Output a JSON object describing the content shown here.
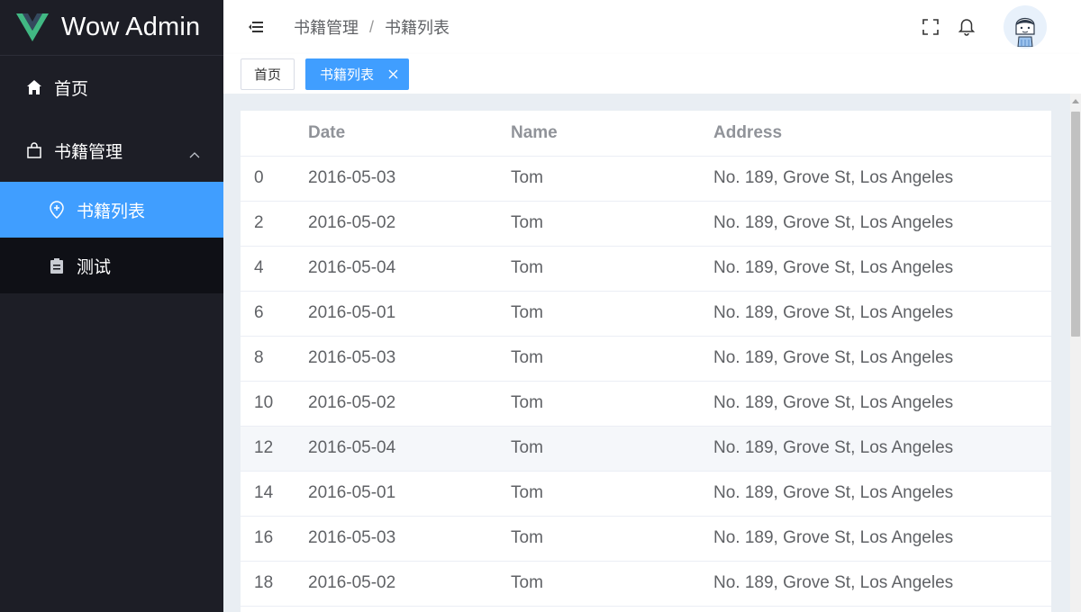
{
  "app": {
    "title": "Wow Admin"
  },
  "sidebar": {
    "home_label": "首页",
    "group_label": "书籍管理",
    "sub_items": [
      {
        "label": "书籍列表",
        "active": true
      },
      {
        "label": "测试",
        "active": false
      }
    ]
  },
  "header": {
    "breadcrumb": [
      "书籍管理",
      "书籍列表"
    ],
    "separator": "/"
  },
  "tags": {
    "home": "首页",
    "active": "书籍列表"
  },
  "table": {
    "columns": [
      "",
      "Date",
      "Name",
      "Address"
    ],
    "rows": [
      [
        "0",
        "2016-05-03",
        "Tom",
        "No. 189, Grove St, Los Angeles"
      ],
      [
        "2",
        "2016-05-02",
        "Tom",
        "No. 189, Grove St, Los Angeles"
      ],
      [
        "4",
        "2016-05-04",
        "Tom",
        "No. 189, Grove St, Los Angeles"
      ],
      [
        "6",
        "2016-05-01",
        "Tom",
        "No. 189, Grove St, Los Angeles"
      ],
      [
        "8",
        "2016-05-03",
        "Tom",
        "No. 189, Grove St, Los Angeles"
      ],
      [
        "10",
        "2016-05-02",
        "Tom",
        "No. 189, Grove St, Los Angeles"
      ],
      [
        "12",
        "2016-05-04",
        "Tom",
        "No. 189, Grove St, Los Angeles"
      ],
      [
        "14",
        "2016-05-01",
        "Tom",
        "No. 189, Grove St, Los Angeles"
      ],
      [
        "16",
        "2016-05-03",
        "Tom",
        "No. 189, Grove St, Los Angeles"
      ],
      [
        "18",
        "2016-05-02",
        "Tom",
        "No. 189, Grove St, Los Angeles"
      ]
    ],
    "hovered_row": 6
  },
  "colors": {
    "sidebar_bg": "#1d1e26",
    "accent": "#409eff",
    "logo_green": "#41b883",
    "logo_dark": "#34495e"
  }
}
